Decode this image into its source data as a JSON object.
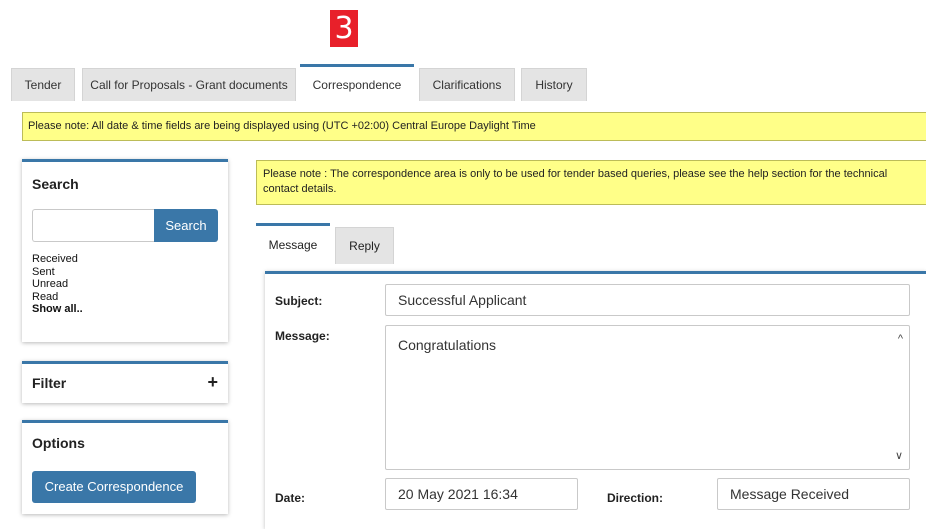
{
  "step_badge": "3",
  "tabs": [
    {
      "label": "Tender"
    },
    {
      "label": "Call for Proposals - Grant documents"
    },
    {
      "label": "Correspondence"
    },
    {
      "label": "Clarifications"
    },
    {
      "label": "History"
    }
  ],
  "timezone_notice": "Please note: All date & time fields are being displayed using (UTC +02:00) Central Europe Daylight Time",
  "search_panel": {
    "title": "Search",
    "input_value": "",
    "button_label": "Search",
    "links": [
      "Received",
      "Sent",
      "Unread",
      "Read",
      "Show all.."
    ]
  },
  "filter_panel": {
    "title": "Filter",
    "toggle_icon": "+"
  },
  "options_panel": {
    "title": "Options",
    "create_button": "Create Correspondence"
  },
  "correspondence_notice": "Please note : The correspondence area is only to be used for tender based queries, please see the help section for the technical contact details.",
  "message_tabs": [
    {
      "label": "Message"
    },
    {
      "label": "Reply"
    }
  ],
  "message": {
    "subject_label": "Subject:",
    "subject_value": "Successful Applicant",
    "message_label": "Message:",
    "message_value": "Congratulations",
    "date_label": "Date:",
    "date_value": "20 May 2021 16:34",
    "direction_label": "Direction:",
    "direction_value": "Message Received"
  },
  "colors": {
    "accent": "#3a77a8",
    "notice_bg": "#ffff88",
    "badge": "#e8202a"
  }
}
